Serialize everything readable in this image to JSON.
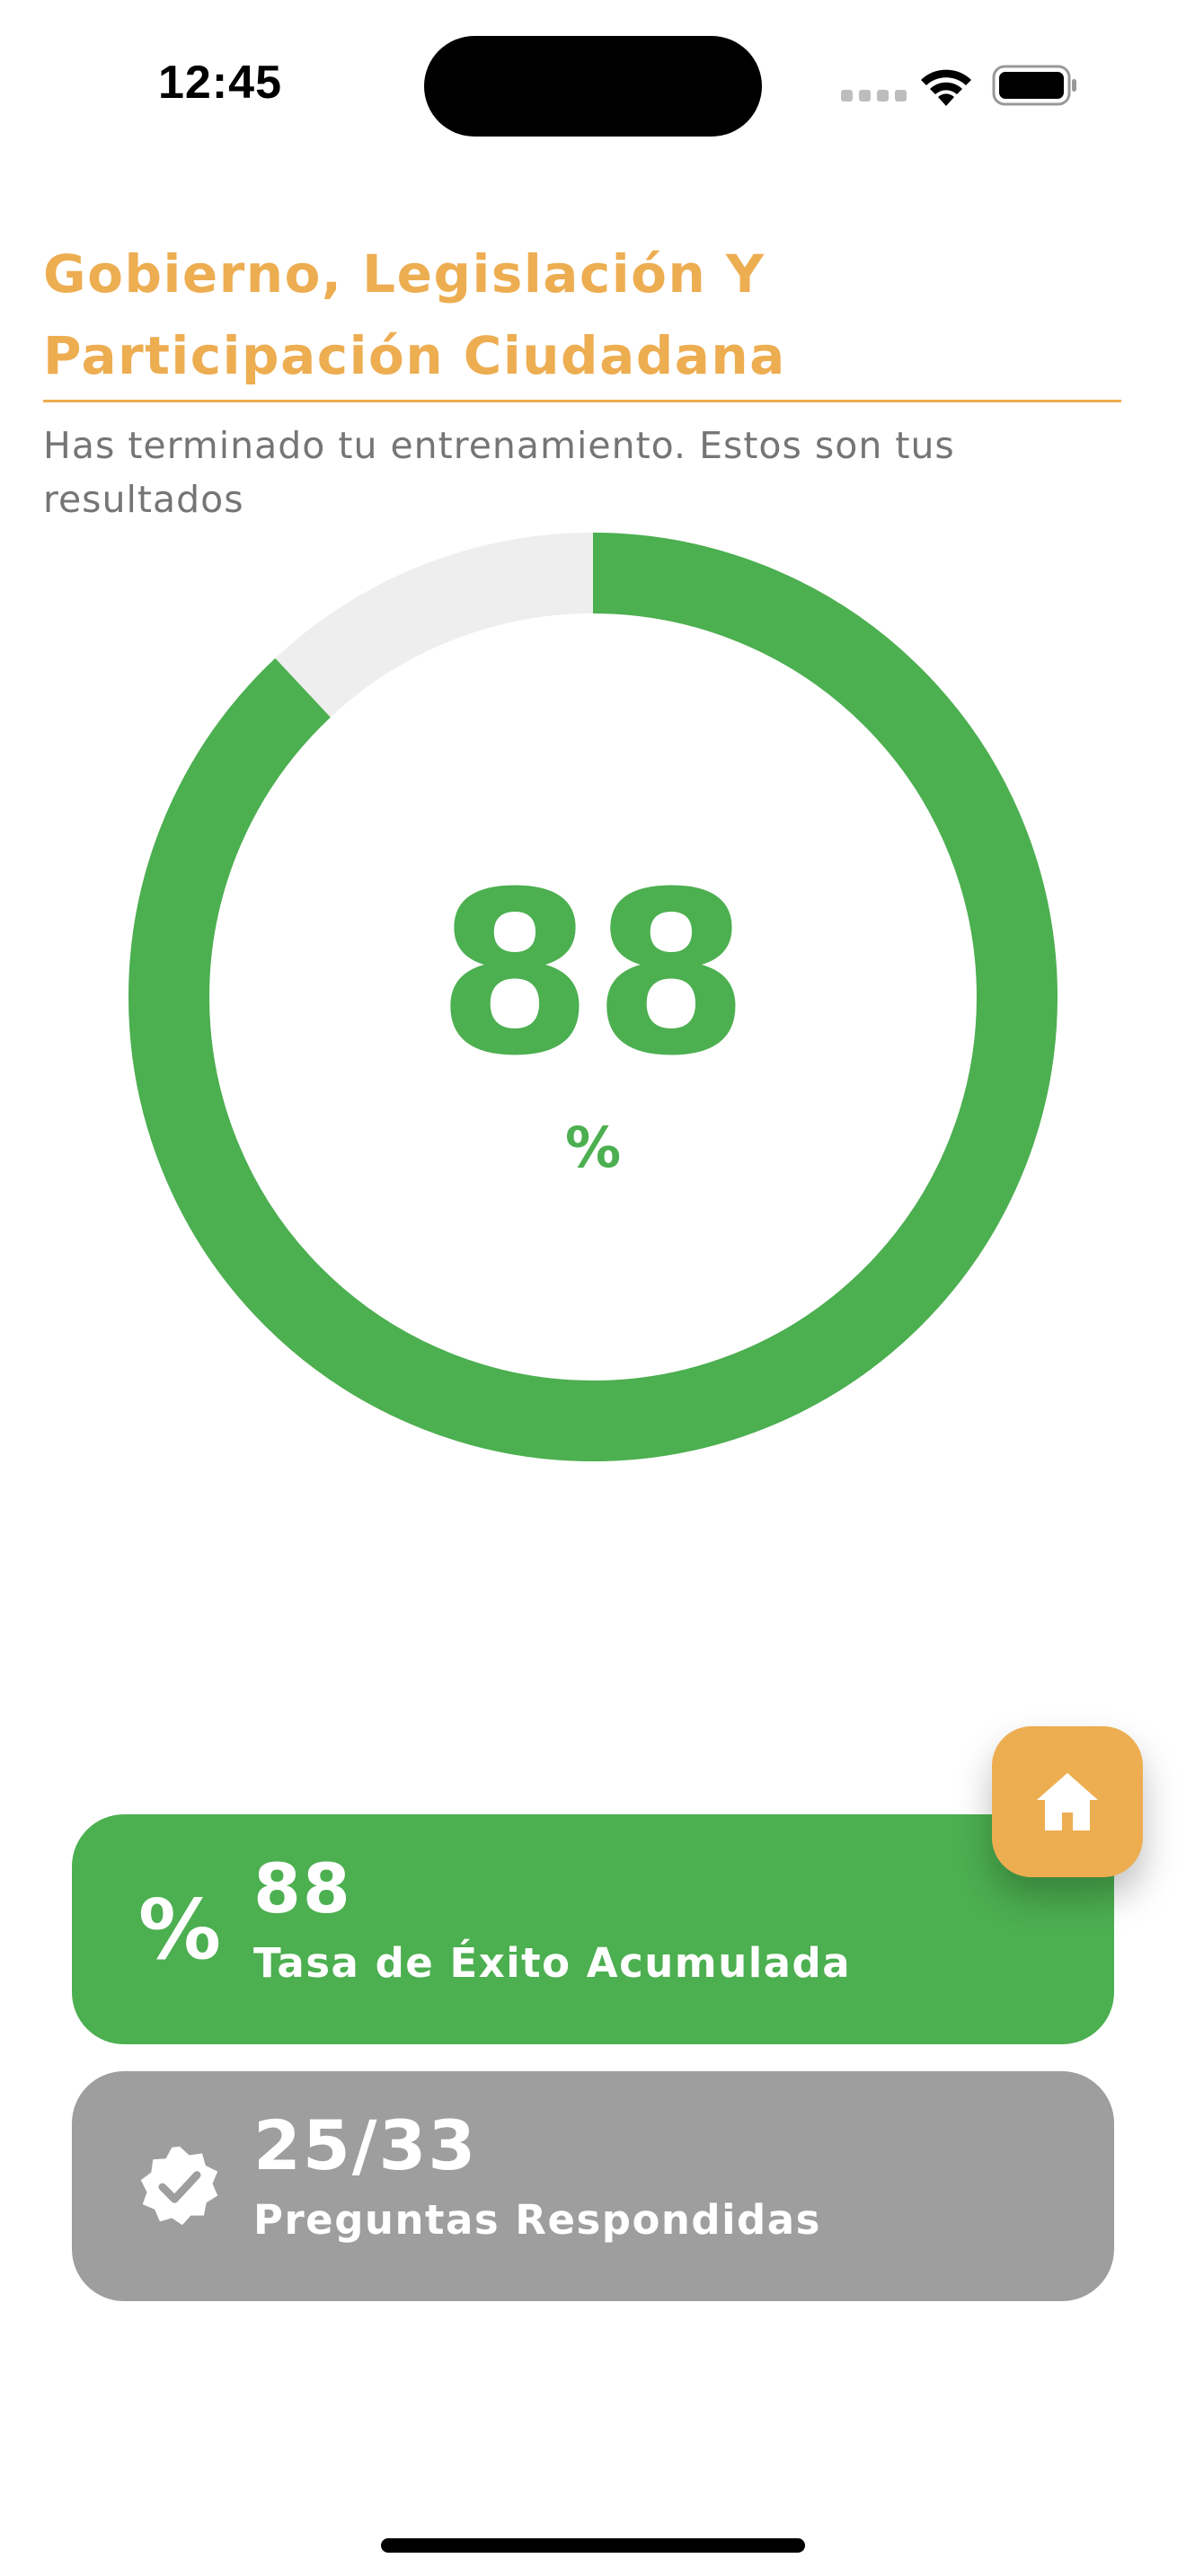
{
  "status_bar": {
    "time": "12:45"
  },
  "header": {
    "title": "Gobierno, Legislación Y Participación Ciudadana",
    "subtitle": "Has terminado tu entrenamiento. Estos son tus resultados"
  },
  "progress": {
    "value": 88,
    "value_label": "88",
    "unit": "%",
    "track_color": "#EEEEEE",
    "fill_color": "#4CAF50"
  },
  "stats": {
    "success_rate": {
      "icon": "percent-icon",
      "value": "88",
      "label": "Tasa de Éxito Acumulada",
      "color": "#4CAF50"
    },
    "answered": {
      "icon": "verified-badge-icon",
      "value": "25/33",
      "label": "Preguntas Respondidas",
      "color": "#9E9E9E"
    }
  },
  "home_button": {
    "icon": "home-icon",
    "color": "#EDAD51"
  }
}
